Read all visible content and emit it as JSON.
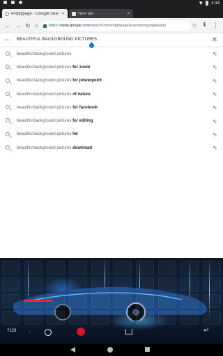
{
  "status_bar": {
    "time": "4:14"
  },
  "tabs": [
    {
      "title": "emptypage - Google Search",
      "active": true
    },
    {
      "title": "New tab",
      "active": false
    }
  ],
  "toolbar": {
    "url_scheme": "https://",
    "url_domain": "www.google.com",
    "url_path": "/search?q=emptypage&oq=emptypage&aqs"
  },
  "search": {
    "query": "BEAUTIFUL  BACKGROUND PICTURES"
  },
  "suggestions": [
    {
      "prefix": "beautiful background pictures",
      "suffix": ""
    },
    {
      "prefix": "beautiful background pictures ",
      "suffix": "for zoom"
    },
    {
      "prefix": "beautiful background pictures ",
      "suffix": "for powerpoint"
    },
    {
      "prefix": "beautiful background pictures ",
      "suffix": "of nature"
    },
    {
      "prefix": "beautiful background pictures ",
      "suffix": "for facebook"
    },
    {
      "prefix": "beautiful background pictures ",
      "suffix": "for editing"
    },
    {
      "prefix": "beautiful background pictures ",
      "suffix": "hd"
    },
    {
      "prefix": "beautiful background pictures ",
      "suffix": "download"
    }
  ],
  "keyboard": {
    "symbols_label": "?123",
    "comma_label": ","
  },
  "icons": {
    "back": "arrow-back-icon",
    "forward": "arrow-forward-icon",
    "reload": "reload-icon",
    "home": "home-icon",
    "star": "star-icon",
    "download": "download-icon",
    "menu": "more-vert-icon",
    "search": "search-icon",
    "fill_query": "arrow-up-left-icon",
    "close": "close-icon"
  },
  "colors": {
    "accent": "#1a73e8",
    "tab_bar": "#1e1f21",
    "toolbar": "#f1f3f4"
  }
}
